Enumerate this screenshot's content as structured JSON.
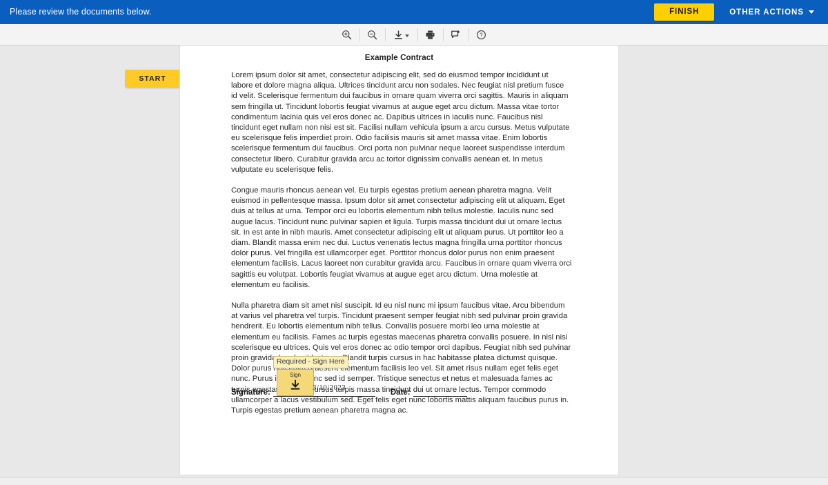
{
  "topbar": {
    "message": "Please review the documents below.",
    "finish_label": "FINISH",
    "other_actions_label": "OTHER ACTIONS",
    "background_color": "#0a5ebd",
    "finish_color": "#ffd000"
  },
  "toolbar": {
    "buttons": [
      {
        "name": "zoom-in-icon",
        "label": "Zoom In"
      },
      {
        "name": "zoom-out-icon",
        "label": "Zoom Out"
      },
      {
        "name": "download-icon",
        "label": "Download"
      },
      {
        "name": "print-icon",
        "label": "Print"
      },
      {
        "name": "add-comment-icon",
        "label": "Add Comment"
      },
      {
        "name": "help-icon",
        "label": "Help"
      }
    ]
  },
  "start_tab": {
    "label": "START",
    "color": "#ffc926"
  },
  "document": {
    "title": "Example Contract",
    "paragraphs": [
      "Lorem ipsum dolor sit amet, consectetur adipiscing elit, sed do eiusmod tempor incididunt ut labore et dolore magna aliqua. Ultrices tincidunt arcu non sodales. Nec feugiat nisl pretium fusce id velit. Scelerisque fermentum dui faucibus in ornare quam viverra orci sagittis. Mauris in aliquam sem fringilla ut. Tincidunt lobortis feugiat vivamus at augue eget arcu dictum. Massa vitae tortor condimentum lacinia quis vel eros donec ac. Dapibus ultrices in iaculis nunc. Faucibus nisl tincidunt eget nullam non nisi est sit. Facilisi nullam vehicula ipsum a arcu cursus. Metus vulputate eu scelerisque felis imperdiet proin. Odio facilisis mauris sit amet massa vitae. Enim lobortis scelerisque fermentum dui faucibus. Orci porta non pulvinar neque laoreet suspendisse interdum consectetur libero. Curabitur gravida arcu ac tortor dignissim convallis aenean et. In metus vulputate eu scelerisque felis.",
      "Congue mauris rhoncus aenean vel. Eu turpis egestas pretium aenean pharetra magna. Velit euismod in pellentesque massa. Ipsum dolor sit amet consectetur adipiscing elit ut aliquam. Eget duis at tellus at urna. Tempor orci eu lobortis elementum nibh tellus molestie. Iaculis nunc sed augue lacus. Tincidunt nunc pulvinar sapien et ligula. Turpis massa tincidunt dui ut ornare lectus sit. In est ante in nibh mauris. Amet consectetur adipiscing elit ut aliquam purus. Ut porttitor leo a diam. Blandit massa enim nec dui. Luctus venenatis lectus magna fringilla urna porttitor rhoncus dolor purus. Vel fringilla est ullamcorper eget. Porttitor rhoncus dolor purus non enim praesent elementum facilisis. Lacus laoreet non curabitur gravida arcu. Faucibus in ornare quam viverra orci sagittis eu volutpat. Lobortis feugiat vivamus at augue eget arcu dictum. Urna molestie at elementum eu facilisis.",
      "Nulla pharetra diam sit amet nisl suscipit. Id eu nisl nunc mi ipsum faucibus vitae. Arcu bibendum at varius vel pharetra vel turpis. Tincidunt praesent semper feugiat nibh sed pulvinar proin gravida hendrerit. Eu lobortis elementum nibh tellus. Convallis posuere morbi leo urna molestie at elementum eu facilisis. Fames ac turpis egestas maecenas pharetra convallis posuere. In nisl nisi scelerisque eu ultrices. Quis vel eros donec ac odio tempor orci dapibus. Feugiat nibh sed pulvinar proin gravida hendrerit lectus a. Blandit turpis cursus in hac habitasse platea dictumst quisque. Dolor purus non enim praesent elementum facilisis leo vel. Sit amet risus nullam eget felis eget nunc. Purus in mollis nunc sed id semper. Tristique senectus et netus et malesuada fames ac turpis egestas. Eros in cursus turpis massa tincidunt dui ut ornare lectus. Tempor commodo ullamcorper a lacus vestibulum sed. Eget felis eget nunc lobortis mattis aliquam faucibus purus in. Turpis egestas pretium aenean pharetra magna ac."
    ],
    "signature_label": "Signature:",
    "date_label": "Date:",
    "date_value": "3/10/2023"
  },
  "sign_field": {
    "label": "Sign",
    "tooltip": "Required - Sign Here",
    "color": "#f5d978"
  }
}
